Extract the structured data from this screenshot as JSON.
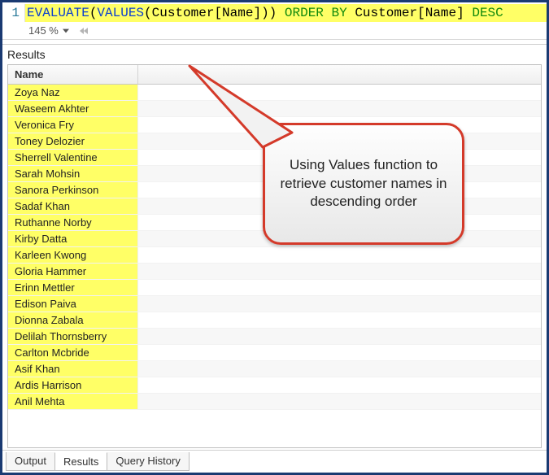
{
  "editor": {
    "line_number": "1",
    "tokens": {
      "evaluate": "EVALUATE",
      "lp1": "(",
      "values": "VALUES",
      "lp2": "(",
      "col1": "Customer[Name]",
      "rp2": ")",
      "rp1": ")",
      "sp1": " ",
      "order_by": "ORDER BY",
      "sp2": " ",
      "col2": "Customer[Name]",
      "sp3": " ",
      "desc": "DESC"
    },
    "zoom": "145 %"
  },
  "results": {
    "panel_title": "Results",
    "column_header": "Name",
    "rows": [
      "Zoya Naz",
      "Waseem Akhter",
      "Veronica Fry",
      "Toney Delozier",
      "Sherrell Valentine",
      "Sarah Mohsin",
      "Sanora Perkinson",
      "Sadaf Khan",
      "Ruthanne Norby",
      "Kirby Datta",
      "Karleen Kwong",
      "Gloria Hammer",
      "Erinn Mettler",
      "Edison Paiva",
      "Dionna Zabala",
      "Delilah Thornsberry",
      "Carlton Mcbride",
      "Asif Khan",
      "Ardis Harrison",
      "Anil Mehta"
    ]
  },
  "callout": {
    "text": "Using Values function  to retrieve customer names in descending order"
  },
  "tabs": {
    "output": "Output",
    "results": "Results",
    "history": "Query History"
  }
}
